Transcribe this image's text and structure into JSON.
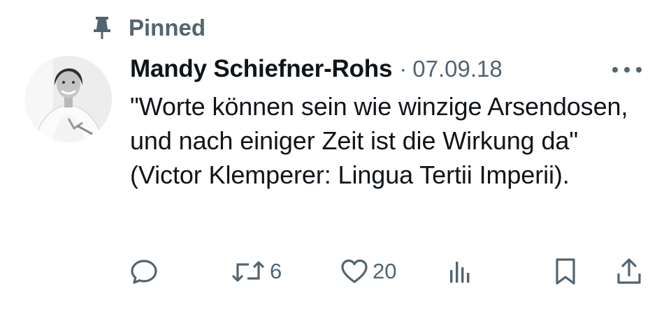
{
  "pinned": {
    "label": "Pinned"
  },
  "tweet": {
    "author_name": "Mandy Schiefner-Rohs",
    "separator": "·",
    "date": "07.09.18",
    "text": "\"Worte können sein wie winzige Arsendosen, und nach einiger Zeit ist die Wirkung da\" (Victor Klemperer: Lingua Tertii Imperii)."
  },
  "actions": {
    "reply_count": "",
    "retweet_count": "6",
    "like_count": "20",
    "views_count": ""
  },
  "icons": {
    "pin": "pin-icon",
    "more": "more-dots-icon",
    "reply": "reply-icon",
    "retweet": "retweet-icon",
    "like": "heart-icon",
    "views": "views-icon",
    "bookmark": "bookmark-icon",
    "share": "share-icon"
  },
  "colors": {
    "text_primary": "#0f1419",
    "text_secondary": "#536471",
    "background": "#ffffff"
  }
}
